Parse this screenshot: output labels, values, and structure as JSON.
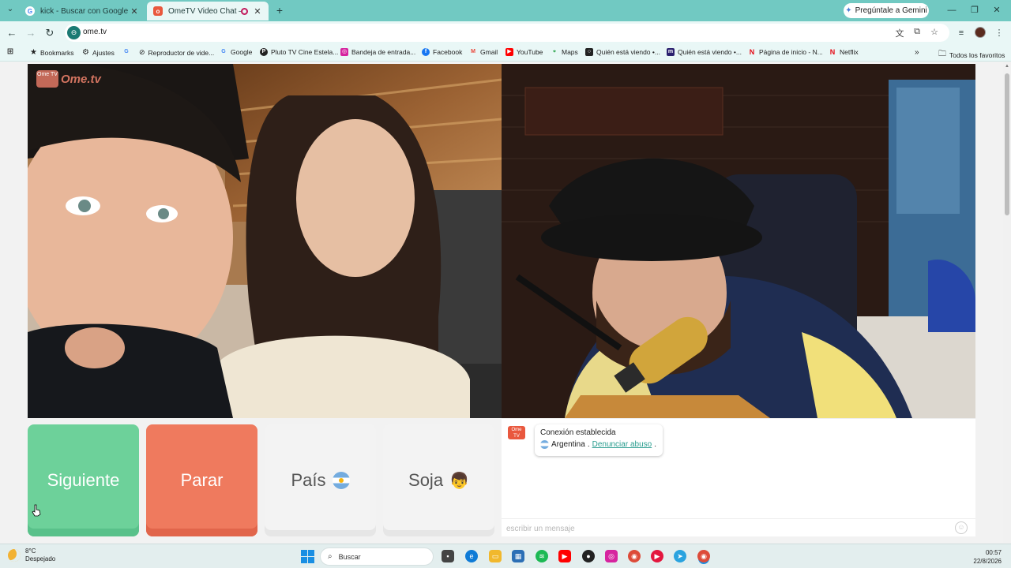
{
  "browser": {
    "tabs": [
      {
        "title": "kick - Buscar con Google",
        "favicon": "google-icon"
      },
      {
        "title": "OmeTV Video Chat — Alterna",
        "favicon": "ometv-icon",
        "recording": true
      }
    ],
    "gemini_label": "Pregúntale a Gemini",
    "url": "ome.tv",
    "bookmarks": [
      {
        "label": "Bookmarks",
        "icon": "star-icon"
      },
      {
        "label": "Ajustes",
        "icon": "gear-icon"
      },
      {
        "label": "",
        "icon": "google-icon"
      },
      {
        "label": "Reproductor de vide...",
        "icon": "video-icon"
      },
      {
        "label": "Google",
        "icon": "google-icon"
      },
      {
        "label": "Pluto TV Cine Estela...",
        "icon": "pluto-icon"
      },
      {
        "label": "Bandeja de entrada...",
        "icon": "instagram-icon"
      },
      {
        "label": "Facebook",
        "icon": "facebook-icon"
      },
      {
        "label": "Gmail",
        "icon": "gmail-icon"
      },
      {
        "label": "YouTube",
        "icon": "youtube-icon"
      },
      {
        "label": "Maps",
        "icon": "maps-icon"
      },
      {
        "label": "Quién está viendo •...",
        "icon": "viewer-icon"
      },
      {
        "label": "Quién está viendo •...",
        "icon": "max-icon"
      },
      {
        "label": "Página de inicio - N...",
        "icon": "netflix-icon"
      },
      {
        "label": "Netflix",
        "icon": "netflix-icon"
      }
    ],
    "all_bookmarks_label": "Todos los favoritos"
  },
  "page": {
    "logo_badge": "Ome TV",
    "logo_text": "Ome.tv",
    "buttons": {
      "next": "Siguiente",
      "stop": "Parar",
      "country": "País",
      "gender": "Soja"
    },
    "chat": {
      "status": "Conexión establecida",
      "country": "Argentina",
      "separator": ".",
      "report_link": "Denunciar abuso",
      "report_suffix": ".",
      "input_placeholder": "escribir un mensaje"
    }
  },
  "taskbar": {
    "weather_temp": "8°C",
    "weather_desc": "Despejado",
    "search_placeholder": "Buscar",
    "time": "00:57",
    "date": "22/8/2026"
  },
  "colors": {
    "chrome_teal": "#71c9c2",
    "next_button": "#6dd19a",
    "stop_button": "#ef7a5e",
    "report_link": "#2a9d8f"
  }
}
